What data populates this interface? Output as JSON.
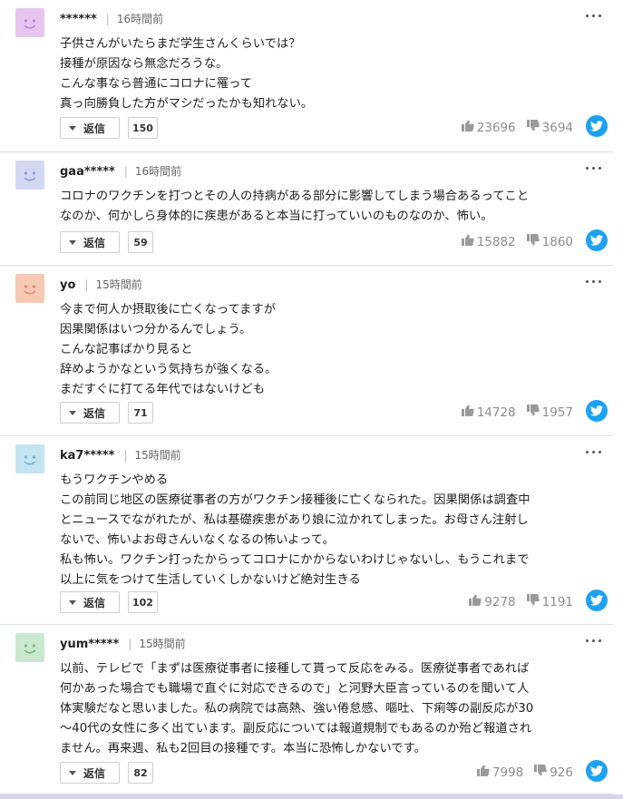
{
  "reply_label": "返信",
  "colors": {
    "twitter": "#1da1f2",
    "vote_gray": "#8c8c8c"
  },
  "icons": {
    "more": "more-icon",
    "like": "thumbs-up-icon",
    "dislike": "thumbs-down-icon",
    "share": "twitter-icon"
  },
  "comments": [
    {
      "avatar_color": "#e6c6ef",
      "avatar_face": "#c084d6",
      "name": "******",
      "time": "16時間前",
      "lines": [
        "子供さんがいたらまだ学生さんくらいでは？",
        "接種が原因なら無念だろうな。",
        "こんな事なら普通にコロナに罹って",
        "真っ向勝負した方がマシだったかも知れない。"
      ],
      "replies": "150",
      "likes": "23696",
      "dislikes": "3694"
    },
    {
      "avatar_color": "#d4d9f3",
      "avatar_face": "#8e9bd8",
      "name": "gaa*****",
      "time": "16時間前",
      "lines": [
        "コロナのワクチンを打つとその人の持病がある部分に影響してしまう場合あるってこと",
        "なのか、何かしら身体的に疾患があると本当に打っていいのものなのか、怖い。"
      ],
      "replies": "59",
      "likes": "15882",
      "dislikes": "1860"
    },
    {
      "avatar_color": "#f6c9b3",
      "avatar_face": "#e58d6a",
      "name": "yo",
      "time": "15時間前",
      "lines": [
        "今まで何人か摂取後に亡くなってますが",
        "因果関係はいつ分かるんでしょう。",
        "こんな記事ばかり見ると",
        "辞めようかなという気持ちが強くなる。",
        "まだすぐに打てる年代ではないけども"
      ],
      "replies": "71",
      "likes": "14728",
      "dislikes": "1957"
    },
    {
      "avatar_color": "#c4e4f1",
      "avatar_face": "#6fb5d6",
      "name": "ka7*****",
      "time": "15時間前",
      "lines": [
        "もうワクチンやめる",
        "この前同じ地区の医療従事者の方がワクチン接種後に亡くなられた。因果関係は調査中",
        "とニュースでながれたが、私は基礎疾患があり娘に泣かれてしまった。お母さん注射し",
        "ないで、怖いよお母さんいなくなるの怖いよって。",
        "私も怖い。ワクチン打ったからってコロナにかからないわけじゃないし、もうこれまで",
        "以上に気をつけて生活していくしかないけど絶対生きる"
      ],
      "replies": "102",
      "likes": "9278",
      "dislikes": "1191"
    },
    {
      "avatar_color": "#c9e8cf",
      "avatar_face": "#73bf82",
      "name": "yum*****",
      "time": "15時間前",
      "lines": [
        "以前、テレビで「まずは医療従事者に接種して貰って反応をみる。医療従事者であれば",
        "何かあった場合でも職場で直ぐに対応できるので」と河野大臣言っているのを聞いて人",
        "体実験だなと思いました。私の病院では高熱、強い倦怠感、嘔吐、下痢等の副反応が30",
        "～40代の女性に多く出ています。副反応については報道規制でもあるのか殆ど報道され",
        "ません。再来週、私も2回目の接種です。本当に恐怖しかないです。"
      ],
      "replies": "82",
      "likes": "7998",
      "dislikes": "926"
    }
  ]
}
